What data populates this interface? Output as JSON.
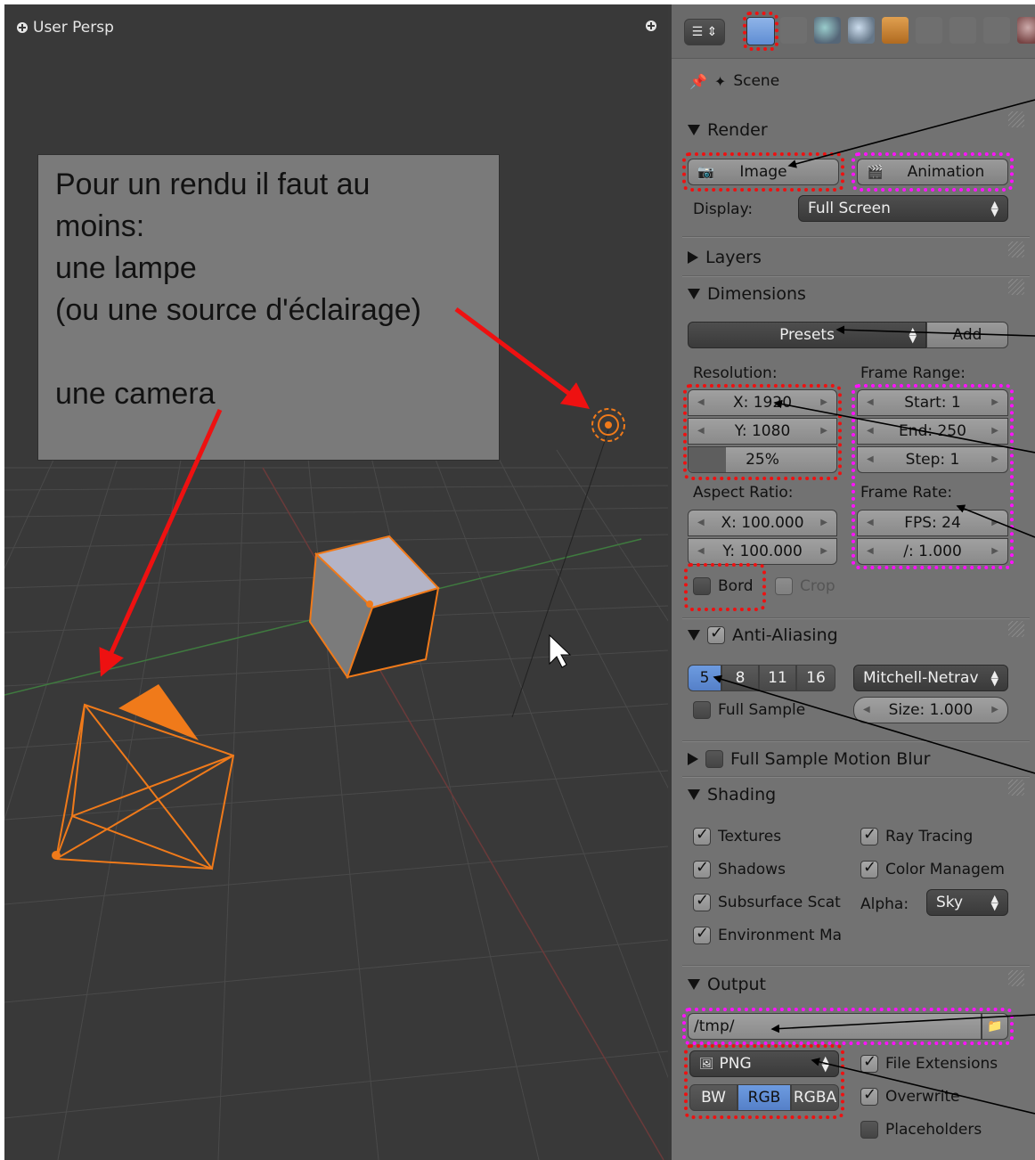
{
  "viewport": {
    "title": "User Persp"
  },
  "annotation": {
    "lines": [
      "Pour un rendu il faut au",
      "moins:",
      "une lampe",
      "(ou une source d'éclairage)",
      "",
      "une camera"
    ]
  },
  "panel": {
    "context": "Scene",
    "render": {
      "header": "Render",
      "image_button": "Image",
      "animation_button": "Animation",
      "display_label": "Display:",
      "display_value": "Full Screen"
    },
    "layers": {
      "header": "Layers"
    },
    "dimensions": {
      "header": "Dimensions",
      "presets": "Presets",
      "add": "Add",
      "resolution_label": "Resolution:",
      "res_x": "X: 1920",
      "res_y": "Y: 1080",
      "res_pct": "25%",
      "res_pct_value": 25,
      "frame_range_label": "Frame Range:",
      "start": "Start: 1",
      "end": "End: 250",
      "step": "Step: 1",
      "aspect_label": "Aspect Ratio:",
      "aspect_x": "X: 100.000",
      "aspect_y": "Y: 100.000",
      "frame_rate_label": "Frame Rate:",
      "fps": "FPS: 24",
      "fps_base": "/: 1.000",
      "border": "Bord",
      "crop": "Crop"
    },
    "anti_aliasing": {
      "header": "Anti-Aliasing",
      "samples": [
        "5",
        "8",
        "11",
        "16"
      ],
      "filter": "Mitchell-Netrav",
      "full_sample": "Full Sample",
      "size": "Size: 1.000"
    },
    "motion_blur": {
      "header": "Full Sample Motion Blur"
    },
    "shading": {
      "header": "Shading",
      "textures": "Textures",
      "ray_tracing": "Ray Tracing",
      "shadows": "Shadows",
      "color_management": "Color Managem",
      "subsurface": "Subsurface Scat",
      "alpha_label": "Alpha:",
      "alpha_value": "Sky",
      "environment": "Environment Ma"
    },
    "output": {
      "header": "Output",
      "path": "/tmp/",
      "format": "PNG",
      "file_extensions": "File Extensions",
      "overwrite": "Overwrite",
      "placeholders": "Placeholders",
      "color_modes": [
        "BW",
        "RGB",
        "RGBA"
      ]
    }
  },
  "colors": {
    "viewport_bg": "#393939",
    "panel_bg": "#727272",
    "selected_orange": "#f07a1a",
    "annotation_red": "#ee1111",
    "annotation_magenta": "#ff10ff",
    "selected_blue": "#5580c8"
  }
}
